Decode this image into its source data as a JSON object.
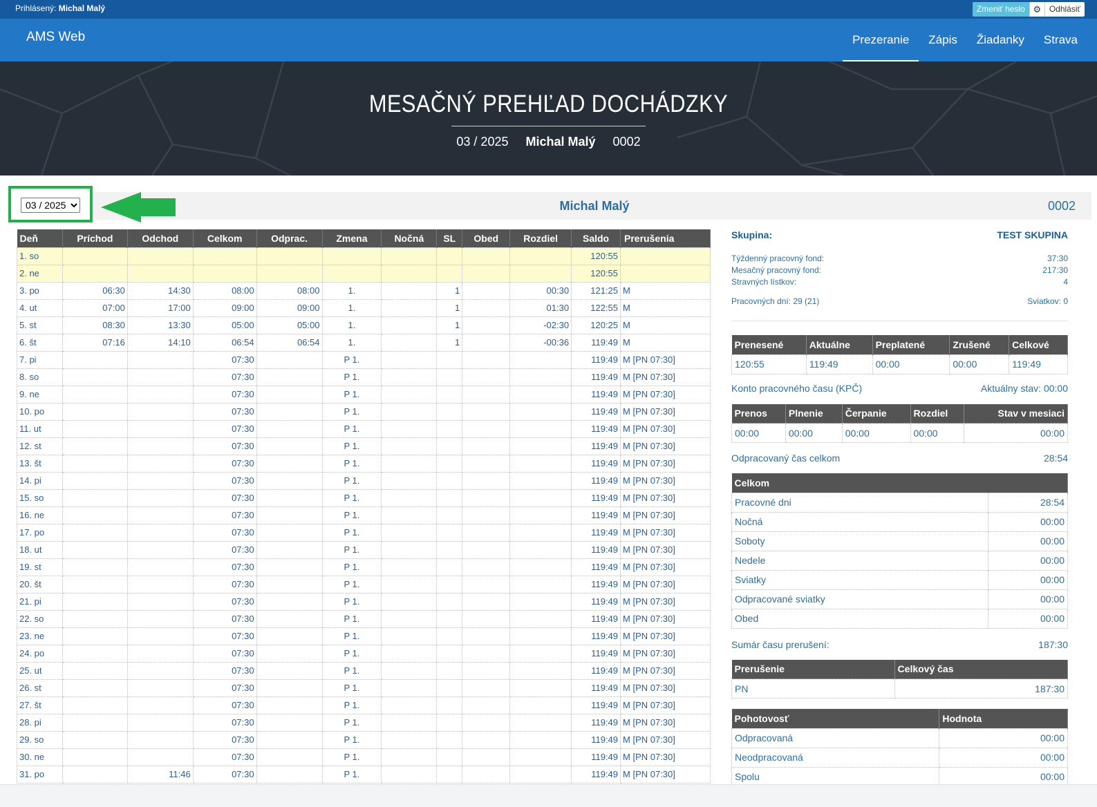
{
  "topbar": {
    "logged_label": "Prihlásený:",
    "logged_user": "Michal Malý",
    "change_password": "Zmeniť heslo",
    "logout": "Odhlásiť"
  },
  "nav": {
    "brand": "AMS Web",
    "items": [
      "Prezeranie",
      "Zápis",
      "Žiadanky",
      "Strava"
    ],
    "active": "Prezeranie"
  },
  "hero": {
    "title": "MESAČNÝ PREHĽAD DOCHÁDZKY",
    "period": "03 / 2025",
    "name": "Michal Malý",
    "code": "0002"
  },
  "selector": {
    "value": "03 / 2025",
    "name": "Michal Malý",
    "code": "0002"
  },
  "attendance": {
    "columns": [
      "Deň",
      "Príchod",
      "Odchod",
      "Celkom",
      "Odprac.",
      "Zmena",
      "Nočná",
      "SL",
      "Obed",
      "Rozdiel",
      "Saldo",
      "Prerušenia"
    ],
    "rows": [
      {
        "d": "1. so",
        "p": "",
        "o": "",
        "c": "",
        "od": "",
        "z": "",
        "n": "",
        "sl": "",
        "ob": "",
        "r": "",
        "s": "120:55",
        "pr": "",
        "weekend": true
      },
      {
        "d": "2. ne",
        "p": "",
        "o": "",
        "c": "",
        "od": "",
        "z": "",
        "n": "",
        "sl": "",
        "ob": "",
        "r": "",
        "s": "120:55",
        "pr": "",
        "weekend": true
      },
      {
        "d": "3. po",
        "p": "06:30",
        "o": "14:30",
        "c": "08:00",
        "od": "08:00",
        "z": "1.",
        "n": "",
        "sl": "1",
        "ob": "",
        "r": "00:30",
        "s": "121:25",
        "pr": "M"
      },
      {
        "d": "4. ut",
        "p": "07:00",
        "o": "17:00",
        "c": "09:00",
        "od": "09:00",
        "z": "1.",
        "n": "",
        "sl": "1",
        "ob": "",
        "r": "01:30",
        "s": "122:55",
        "pr": "M"
      },
      {
        "d": "5. st",
        "p": "08:30",
        "o": "13:30",
        "c": "05:00",
        "od": "05:00",
        "z": "1.",
        "n": "",
        "sl": "1",
        "ob": "",
        "r": "-02:30",
        "s": "120:25",
        "pr": "M"
      },
      {
        "d": "6. št",
        "p": "07:16",
        "o": "14:10",
        "c": "06:54",
        "od": "06:54",
        "z": "1.",
        "n": "",
        "sl": "1",
        "ob": "",
        "r": "-00:36",
        "s": "119:49",
        "pr": "M"
      },
      {
        "d": "7. pi",
        "p": "",
        "o": "",
        "c": "07:30",
        "od": "",
        "z": "P 1.",
        "n": "",
        "sl": "",
        "ob": "",
        "r": "",
        "s": "119:49",
        "pr": "M [PN 07:30]"
      },
      {
        "d": "8. so",
        "p": "",
        "o": "",
        "c": "07:30",
        "od": "",
        "z": "P 1.",
        "n": "",
        "sl": "",
        "ob": "",
        "r": "",
        "s": "119:49",
        "pr": "M [PN 07:30]"
      },
      {
        "d": "9. ne",
        "p": "",
        "o": "",
        "c": "07:30",
        "od": "",
        "z": "P 1.",
        "n": "",
        "sl": "",
        "ob": "",
        "r": "",
        "s": "119:49",
        "pr": "M [PN 07:30]"
      },
      {
        "d": "10. po",
        "p": "",
        "o": "",
        "c": "07:30",
        "od": "",
        "z": "P 1.",
        "n": "",
        "sl": "",
        "ob": "",
        "r": "",
        "s": "119:49",
        "pr": "M [PN 07:30]"
      },
      {
        "d": "11. ut",
        "p": "",
        "o": "",
        "c": "07:30",
        "od": "",
        "z": "P 1.",
        "n": "",
        "sl": "",
        "ob": "",
        "r": "",
        "s": "119:49",
        "pr": "M [PN 07:30]"
      },
      {
        "d": "12. st",
        "p": "",
        "o": "",
        "c": "07:30",
        "od": "",
        "z": "P 1.",
        "n": "",
        "sl": "",
        "ob": "",
        "r": "",
        "s": "119:49",
        "pr": "M [PN 07:30]"
      },
      {
        "d": "13. št",
        "p": "",
        "o": "",
        "c": "07:30",
        "od": "",
        "z": "P 1.",
        "n": "",
        "sl": "",
        "ob": "",
        "r": "",
        "s": "119:49",
        "pr": "M [PN 07:30]"
      },
      {
        "d": "14. pi",
        "p": "",
        "o": "",
        "c": "07:30",
        "od": "",
        "z": "P 1.",
        "n": "",
        "sl": "",
        "ob": "",
        "r": "",
        "s": "119:49",
        "pr": "M [PN 07:30]"
      },
      {
        "d": "15. so",
        "p": "",
        "o": "",
        "c": "07:30",
        "od": "",
        "z": "P 1.",
        "n": "",
        "sl": "",
        "ob": "",
        "r": "",
        "s": "119:49",
        "pr": "M [PN 07:30]"
      },
      {
        "d": "16. ne",
        "p": "",
        "o": "",
        "c": "07:30",
        "od": "",
        "z": "P 1.",
        "n": "",
        "sl": "",
        "ob": "",
        "r": "",
        "s": "119:49",
        "pr": "M [PN 07:30]"
      },
      {
        "d": "17. po",
        "p": "",
        "o": "",
        "c": "07:30",
        "od": "",
        "z": "P 1.",
        "n": "",
        "sl": "",
        "ob": "",
        "r": "",
        "s": "119:49",
        "pr": "M [PN 07:30]"
      },
      {
        "d": "18. ut",
        "p": "",
        "o": "",
        "c": "07:30",
        "od": "",
        "z": "P 1.",
        "n": "",
        "sl": "",
        "ob": "",
        "r": "",
        "s": "119:49",
        "pr": "M [PN 07:30]"
      },
      {
        "d": "19. st",
        "p": "",
        "o": "",
        "c": "07:30",
        "od": "",
        "z": "P 1.",
        "n": "",
        "sl": "",
        "ob": "",
        "r": "",
        "s": "119:49",
        "pr": "M [PN 07:30]"
      },
      {
        "d": "20. št",
        "p": "",
        "o": "",
        "c": "07:30",
        "od": "",
        "z": "P 1.",
        "n": "",
        "sl": "",
        "ob": "",
        "r": "",
        "s": "119:49",
        "pr": "M [PN 07:30]"
      },
      {
        "d": "21. pi",
        "p": "",
        "o": "",
        "c": "07:30",
        "od": "",
        "z": "P 1.",
        "n": "",
        "sl": "",
        "ob": "",
        "r": "",
        "s": "119:49",
        "pr": "M [PN 07:30]"
      },
      {
        "d": "22. so",
        "p": "",
        "o": "",
        "c": "07:30",
        "od": "",
        "z": "P 1.",
        "n": "",
        "sl": "",
        "ob": "",
        "r": "",
        "s": "119:49",
        "pr": "M [PN 07:30]"
      },
      {
        "d": "23. ne",
        "p": "",
        "o": "",
        "c": "07:30",
        "od": "",
        "z": "P 1.",
        "n": "",
        "sl": "",
        "ob": "",
        "r": "",
        "s": "119:49",
        "pr": "M [PN 07:30]"
      },
      {
        "d": "24. po",
        "p": "",
        "o": "",
        "c": "07:30",
        "od": "",
        "z": "P 1.",
        "n": "",
        "sl": "",
        "ob": "",
        "r": "",
        "s": "119:49",
        "pr": "M [PN 07:30]"
      },
      {
        "d": "25. ut",
        "p": "",
        "o": "",
        "c": "07:30",
        "od": "",
        "z": "P 1.",
        "n": "",
        "sl": "",
        "ob": "",
        "r": "",
        "s": "119:49",
        "pr": "M [PN 07:30]"
      },
      {
        "d": "26. st",
        "p": "",
        "o": "",
        "c": "07:30",
        "od": "",
        "z": "P 1.",
        "n": "",
        "sl": "",
        "ob": "",
        "r": "",
        "s": "119:49",
        "pr": "M [PN 07:30]"
      },
      {
        "d": "27. št",
        "p": "",
        "o": "",
        "c": "07:30",
        "od": "",
        "z": "P 1.",
        "n": "",
        "sl": "",
        "ob": "",
        "r": "",
        "s": "119:49",
        "pr": "M [PN 07:30]"
      },
      {
        "d": "28. pi",
        "p": "",
        "o": "",
        "c": "07:30",
        "od": "",
        "z": "P 1.",
        "n": "",
        "sl": "",
        "ob": "",
        "r": "",
        "s": "119:49",
        "pr": "M [PN 07:30]"
      },
      {
        "d": "29. so",
        "p": "",
        "o": "",
        "c": "07:30",
        "od": "",
        "z": "P 1.",
        "n": "",
        "sl": "",
        "ob": "",
        "r": "",
        "s": "119:49",
        "pr": "M [PN 07:30]"
      },
      {
        "d": "30. ne",
        "p": "",
        "o": "",
        "c": "07:30",
        "od": "",
        "z": "P 1.",
        "n": "",
        "sl": "",
        "ob": "",
        "r": "",
        "s": "119:49",
        "pr": "M [PN 07:30]"
      },
      {
        "d": "31. po",
        "p": "",
        "o": "11:46",
        "c": "07:30",
        "od": "",
        "z": "P 1.",
        "n": "",
        "sl": "",
        "ob": "",
        "r": "",
        "s": "119:49",
        "pr": "M [PN 07:30]"
      }
    ]
  },
  "summary": {
    "group_label": "Skupina:",
    "group_value": "TEST SKUPINA",
    "weekly_fund_label": "Týždenný pracovný fond:",
    "weekly_fund_value": "37:30",
    "monthly_fund_label": "Mesačný pracovný fond:",
    "monthly_fund_value": "217:30",
    "tickets_label": "Stravných lístkov:",
    "tickets_value": "4",
    "workdays_label": "Pracovných dní: 29 (21)",
    "holidays_label": "Sviatkov: 0",
    "balance_table": {
      "columns": [
        "Prenesené",
        "Aktuálne",
        "Preplatené",
        "Zrušené",
        "Celkové"
      ],
      "values": [
        "120:55",
        "119:49",
        "00:00",
        "00:00",
        "119:49"
      ]
    },
    "kpc_label": "Konto pracovného času (KPČ)",
    "kpc_state": "Aktuálny stav: 00:00",
    "kpc_table": {
      "columns": [
        "Prenos",
        "Plnenie",
        "Čerpanie",
        "Rozdiel",
        "Stav v mesiaci"
      ],
      "values": [
        "00:00",
        "00:00",
        "00:00",
        "00:00",
        "00:00"
      ]
    },
    "worked_total_label": "Odpracovaný čas celkom",
    "worked_total_value": "28:54",
    "total_table": {
      "header": "Celkom",
      "rows": [
        {
          "label": "Pracovné dni",
          "value": "28:54"
        },
        {
          "label": "Nočná",
          "value": "00:00"
        },
        {
          "label": "Soboty",
          "value": "00:00"
        },
        {
          "label": "Nedele",
          "value": "00:00"
        },
        {
          "label": "Sviatky",
          "value": "00:00"
        },
        {
          "label": "Odpracované sviatky",
          "value": "00:00"
        },
        {
          "label": "Obed",
          "value": "00:00"
        }
      ]
    },
    "interrupt_sum_label": "Sumár času prerušení:",
    "interrupt_sum_value": "187:30",
    "interrupt_table": {
      "columns": [
        "Prerušenie",
        "Celkový čas"
      ],
      "rows": [
        {
          "label": "PN",
          "value": "187:30"
        }
      ]
    },
    "standby_table": {
      "columns": [
        "Pohotovosť",
        "Hodnota"
      ],
      "rows": [
        {
          "label": "Odpracovaná",
          "value": "00:00"
        },
        {
          "label": "Neodpracovaná",
          "value": "00:00"
        },
        {
          "label": "Spolu",
          "value": "00:00"
        }
      ]
    }
  }
}
